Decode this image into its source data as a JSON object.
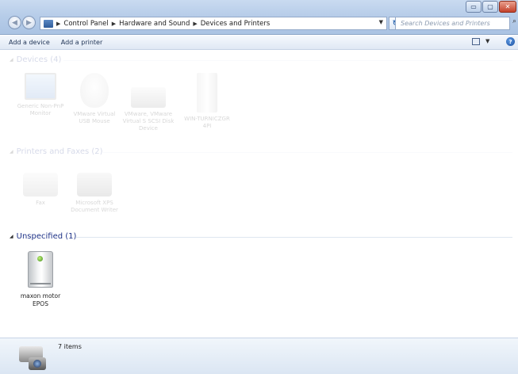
{
  "window": {
    "buttons": {
      "minimize": "▭",
      "maximize": "▢",
      "close": "✕"
    }
  },
  "address": {
    "crumbs": [
      "Control Panel",
      "Hardware and Sound",
      "Devices and Printers"
    ],
    "search_placeholder": "Search Devices and Printers"
  },
  "commands": {
    "add_device": "Add a device",
    "add_printer": "Add a printer"
  },
  "groups": {
    "devices": {
      "title": "Devices (4)",
      "items": [
        {
          "label": "Generic Non-PnP Monitor",
          "icon": "monitor-icon"
        },
        {
          "label": "VMware Virtual USB Mouse",
          "icon": "mouse-icon"
        },
        {
          "label": "VMware, VMware Virtual S SCSI Disk Device",
          "icon": "drive-icon"
        },
        {
          "label": "WIN-TURNICZGR 4PI",
          "icon": "computer-icon"
        }
      ]
    },
    "printers": {
      "title": "Printers and Faxes (2)",
      "items": [
        {
          "label": "Fax",
          "icon": "fax-icon"
        },
        {
          "label": "Microsoft XPS Document Writer",
          "icon": "printer-icon"
        }
      ]
    },
    "unspecified": {
      "title": "Unspecified (1)",
      "items": [
        {
          "label_line1": "maxon motor",
          "label_line2": "EPOS",
          "icon": "tower-device-icon"
        }
      ]
    }
  },
  "details": {
    "count": "7 items"
  },
  "colors": {
    "group_header": "#1e3287",
    "titlebar": "#b7cde9",
    "details_pane": "#dbe6f3"
  }
}
